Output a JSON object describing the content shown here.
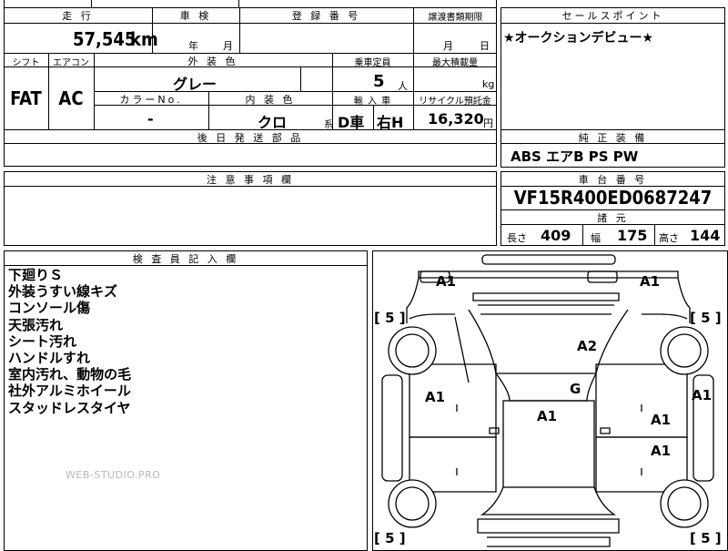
{
  "mileage": {
    "label": "走 行",
    "value": "57,545",
    "unit": "km"
  },
  "inspection": {
    "label": "車 検",
    "year": "年",
    "month": "月"
  },
  "registration": {
    "label": "登 録 番 号"
  },
  "transfer": {
    "label": "譲渡書類期限",
    "month": "月",
    "day": "日"
  },
  "sales_point": {
    "label": "セールスポイント",
    "text": "★オークションデビュー★"
  },
  "shift": {
    "label": "シフト",
    "value": "FAT"
  },
  "ac": {
    "label": "エアコン",
    "value": "AC"
  },
  "exterior_color": {
    "label": "外 装 色",
    "value": "グレー"
  },
  "capacity": {
    "label": "乗車定員",
    "value": "5",
    "unit": "人"
  },
  "max_load": {
    "label": "最大積載量",
    "unit": "kg"
  },
  "color_no": {
    "label": "カラーNo.",
    "value": "-"
  },
  "interior_color": {
    "label": "内 装 色",
    "value": "クロ",
    "suffix": "系"
  },
  "import": {
    "label": "輸 入 車",
    "value1": "D車",
    "value2": "右H"
  },
  "recycle": {
    "label": "リサイクル預託金",
    "value": "16,320",
    "unit": "円"
  },
  "later_parts": {
    "label": "後 日 発 送 部 品"
  },
  "equipment": {
    "label": "純 正 装 備",
    "value": "ABS エアB PS PW"
  },
  "notes": {
    "label": "注 意 事 項 欄"
  },
  "chassis": {
    "label": "車 台 番 号",
    "value": "VF15R400ED0687247"
  },
  "dimensions": {
    "label": "諸 元",
    "length_label": "長さ",
    "length": "409",
    "width_label": "幅",
    "width": "175",
    "height_label": "高さ",
    "height": "144"
  },
  "inspector": {
    "label": "検 査 員 記 入 欄",
    "lines": [
      "下廻りＳ",
      "外装うすい線キズ",
      "コンソール傷",
      "天張汚れ",
      "シート汚れ",
      "ハンドルすれ",
      "室内汚れ、動物の毛",
      "社外アルミホイール",
      "スタッドレスタイヤ"
    ],
    "watermark": "WEB-STUDIO.PRO"
  },
  "diagram": {
    "grades": [
      {
        "id": "front-left",
        "text": "A1"
      },
      {
        "id": "front-right",
        "text": "A1"
      },
      {
        "id": "hood",
        "text": "A2"
      },
      {
        "id": "left-front-door",
        "text": "A1"
      },
      {
        "id": "right-side",
        "text": "A1"
      },
      {
        "id": "windshield",
        "text": "G"
      },
      {
        "id": "roof",
        "text": "A1"
      },
      {
        "id": "right-front-door",
        "text": "A1"
      },
      {
        "id": "right-rear-door",
        "text": "A1"
      }
    ],
    "tires": [
      {
        "id": "front-left",
        "text": "[ 5 ]"
      },
      {
        "id": "front-right",
        "text": "[ 5 ]"
      },
      {
        "id": "rear-left",
        "text": "[ 5 ]"
      },
      {
        "id": "rear-right",
        "text": "[ 5 ]"
      }
    ]
  }
}
